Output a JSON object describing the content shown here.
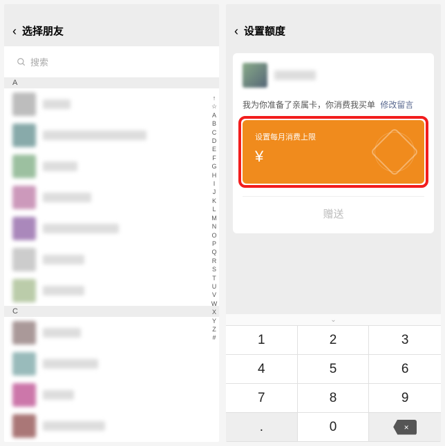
{
  "left": {
    "title": "选择朋友",
    "search_placeholder": "搜索",
    "sections": [
      {
        "letter": "A",
        "count": 7
      },
      {
        "letter": "C",
        "count": 4
      }
    ],
    "alpha_index": [
      "↑",
      "☆",
      "A",
      "B",
      "C",
      "D",
      "E",
      "F",
      "G",
      "H",
      "I",
      "J",
      "K",
      "L",
      "M",
      "N",
      "O",
      "P",
      "Q",
      "R",
      "S",
      "T",
      "U",
      "V",
      "W",
      "X",
      "Y",
      "Z",
      "#"
    ]
  },
  "right": {
    "title": "设置额度",
    "message": "我为你准备了亲属卡，你消费我买单",
    "edit_link": "修改留言",
    "limit_label": "设置每月消费上限",
    "currency": "¥",
    "gift_button": "赠送",
    "keypad": {
      "rows": [
        [
          "1",
          "2",
          "3"
        ],
        [
          "4",
          "5",
          "6"
        ],
        [
          "7",
          "8",
          "9"
        ],
        [
          ".",
          "0",
          "backspace"
        ]
      ]
    }
  }
}
